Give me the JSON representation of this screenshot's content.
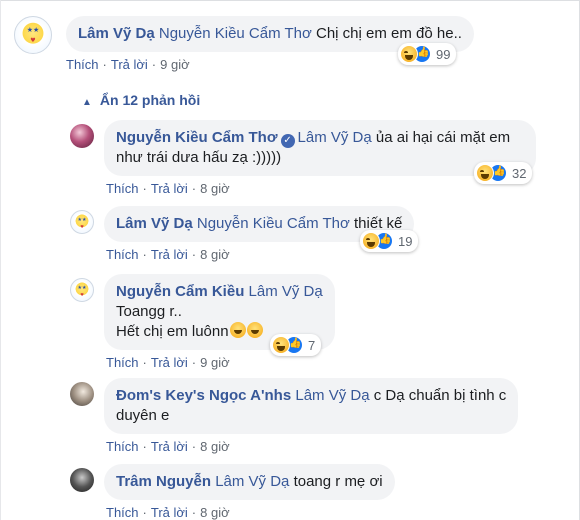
{
  "comments": [
    {
      "author": "Lâm Vỹ Dạ",
      "mention": "Nguyễn Kiều Cẩm Thơ",
      "text": " Chị chị em em đồ he..",
      "like_label": "Thích",
      "reply_label": "Trả lời",
      "time": "9 giờ",
      "reaction_count": "99"
    }
  ],
  "hide_replies_label": "Ẩn 12 phản hồi",
  "replies": [
    {
      "author": "Nguyễn Kiều Cẩm Thơ",
      "mention": "Lâm Vỹ Dạ",
      "text_line1": " ủa ai hại cái mặt em",
      "text_line2": "như trái dưa hấu zạ :)))))",
      "like_label": "Thích",
      "reply_label": "Trả lời",
      "time": "8 giờ",
      "reaction_count": "32"
    },
    {
      "author": "Lâm Vỹ Dạ",
      "mention": "Nguyễn Kiều Cẩm Thơ",
      "text": " thiết kế",
      "like_label": "Thích",
      "reply_label": "Trả lời",
      "time": "8 giờ",
      "reaction_count": "19"
    },
    {
      "author": "Nguyễn Cẩm Kiều",
      "mention": "Lâm Vỹ Dạ",
      "text_line1": "Toangg r..",
      "text_line2": "Hết chị em luônn",
      "like_label": "Thích",
      "reply_label": "Trả lời",
      "time": "9 giờ",
      "reaction_count": "7"
    },
    {
      "author": "Đom's Key's Ngọc A'nhs",
      "mention": "Lâm Vỹ Dạ",
      "text_line1": " c Dạ chuẩn bị tình c",
      "text_line2": "duyên e",
      "like_label": "Thích",
      "reply_label": "Trả lời",
      "time": "8 giờ"
    },
    {
      "author": "Trâm Nguyễn",
      "mention": "Lâm Vỹ Dạ",
      "text": " toang r mẹ ơi",
      "like_label": "Thích",
      "reply_label": "Trả lời",
      "time": "8 giờ"
    }
  ],
  "icons": {
    "verified": "verified-badge-icon",
    "haha": "haha-reaction-icon",
    "like": "like-reaction-icon",
    "chevron": "chevron-up-icon"
  },
  "colors": {
    "link": "#385898",
    "bubble": "#f2f3f5",
    "muted": "#606770",
    "like_blue": "#1877f2"
  }
}
